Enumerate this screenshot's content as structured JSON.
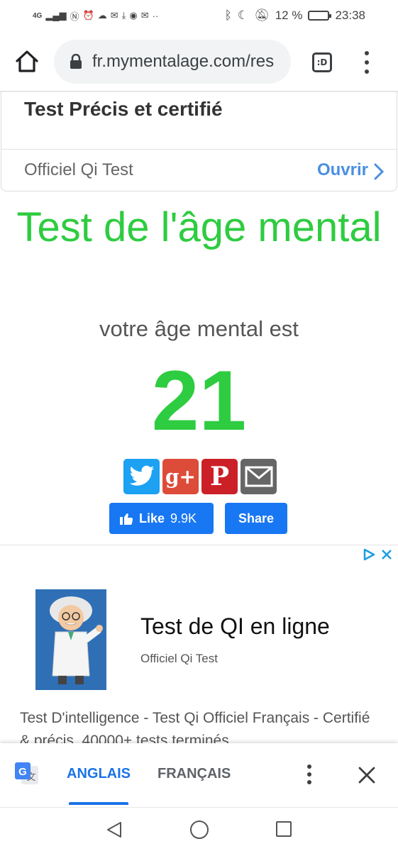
{
  "status_bar": {
    "network": "4G",
    "battery_percent": "12 %",
    "time": "23:38"
  },
  "browser": {
    "url": "fr.mymentalage.com/res",
    "tab_switcher_label": ":D"
  },
  "ad_top": {
    "title": "Test Précis et certifié",
    "source": "Officiel Qi Test",
    "open_label": "Ouvrir"
  },
  "result": {
    "headline": "Test de l'âge mental",
    "subtitle": "votre âge mental est",
    "age": "21"
  },
  "social": {
    "icons": [
      "twitter-icon",
      "google-plus-icon",
      "pinterest-icon",
      "email-icon"
    ],
    "fb_like_label": "Like",
    "fb_like_count": "9.9K",
    "fb_share_label": "Share"
  },
  "ad_bottom": {
    "title": "Test de QI en ligne",
    "source": "Officiel Qi Test",
    "description": "Test D'intelligence - Test Qi Officiel Français - Certifié & précis. 40000+ tests terminés"
  },
  "translate_bar": {
    "tab_source": "ANGLAIS",
    "tab_target": "FRANÇAIS"
  },
  "colors": {
    "accent_green": "#2ecc40",
    "facebook_blue": "#1877f2",
    "translate_blue": "#1a73e8"
  }
}
